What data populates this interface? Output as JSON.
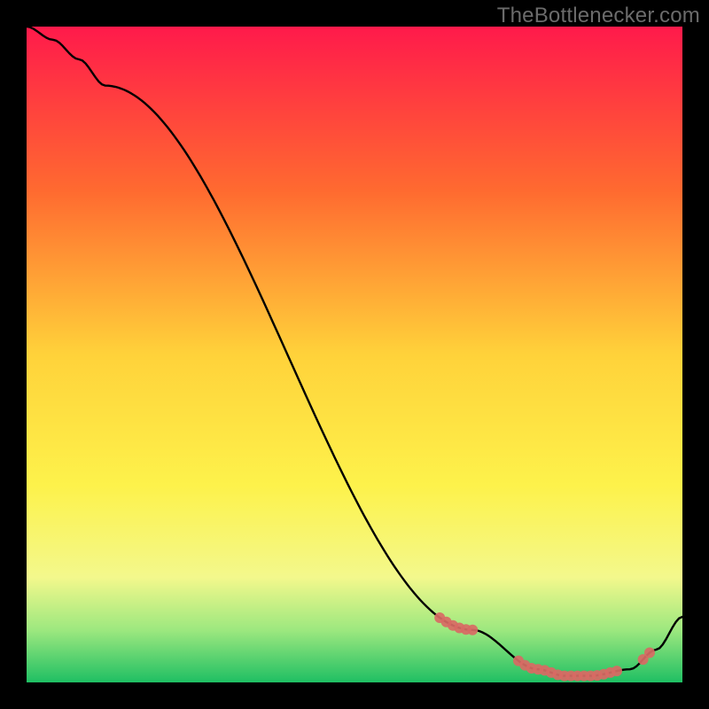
{
  "attribution": "TheBottlenecker.com",
  "chart_data": {
    "type": "line",
    "title": "",
    "xlabel": "",
    "ylabel": "",
    "x": [
      0,
      4,
      8,
      12,
      68,
      78,
      82,
      86,
      92,
      96,
      100
    ],
    "values": [
      100,
      98,
      95,
      91,
      8,
      2,
      1,
      1,
      2,
      5,
      10
    ],
    "gradient_stops": [
      {
        "offset": 0,
        "color": "#ff1a4b"
      },
      {
        "offset": 25,
        "color": "#ff6a30"
      },
      {
        "offset": 50,
        "color": "#ffd23a"
      },
      {
        "offset": 70,
        "color": "#fdf24b"
      },
      {
        "offset": 84,
        "color": "#f3f88c"
      },
      {
        "offset": 92,
        "color": "#9de87f"
      },
      {
        "offset": 100,
        "color": "#1fbf63"
      }
    ],
    "marker_color": "#d86a64",
    "markers_x": [
      63,
      64,
      65,
      66,
      67,
      68,
      75,
      76,
      77,
      78,
      79,
      80,
      81,
      82,
      83,
      84,
      85,
      86,
      87,
      88,
      89,
      90,
      94,
      95
    ],
    "xlim": [
      0,
      100
    ],
    "ylim": [
      0,
      100
    ]
  }
}
